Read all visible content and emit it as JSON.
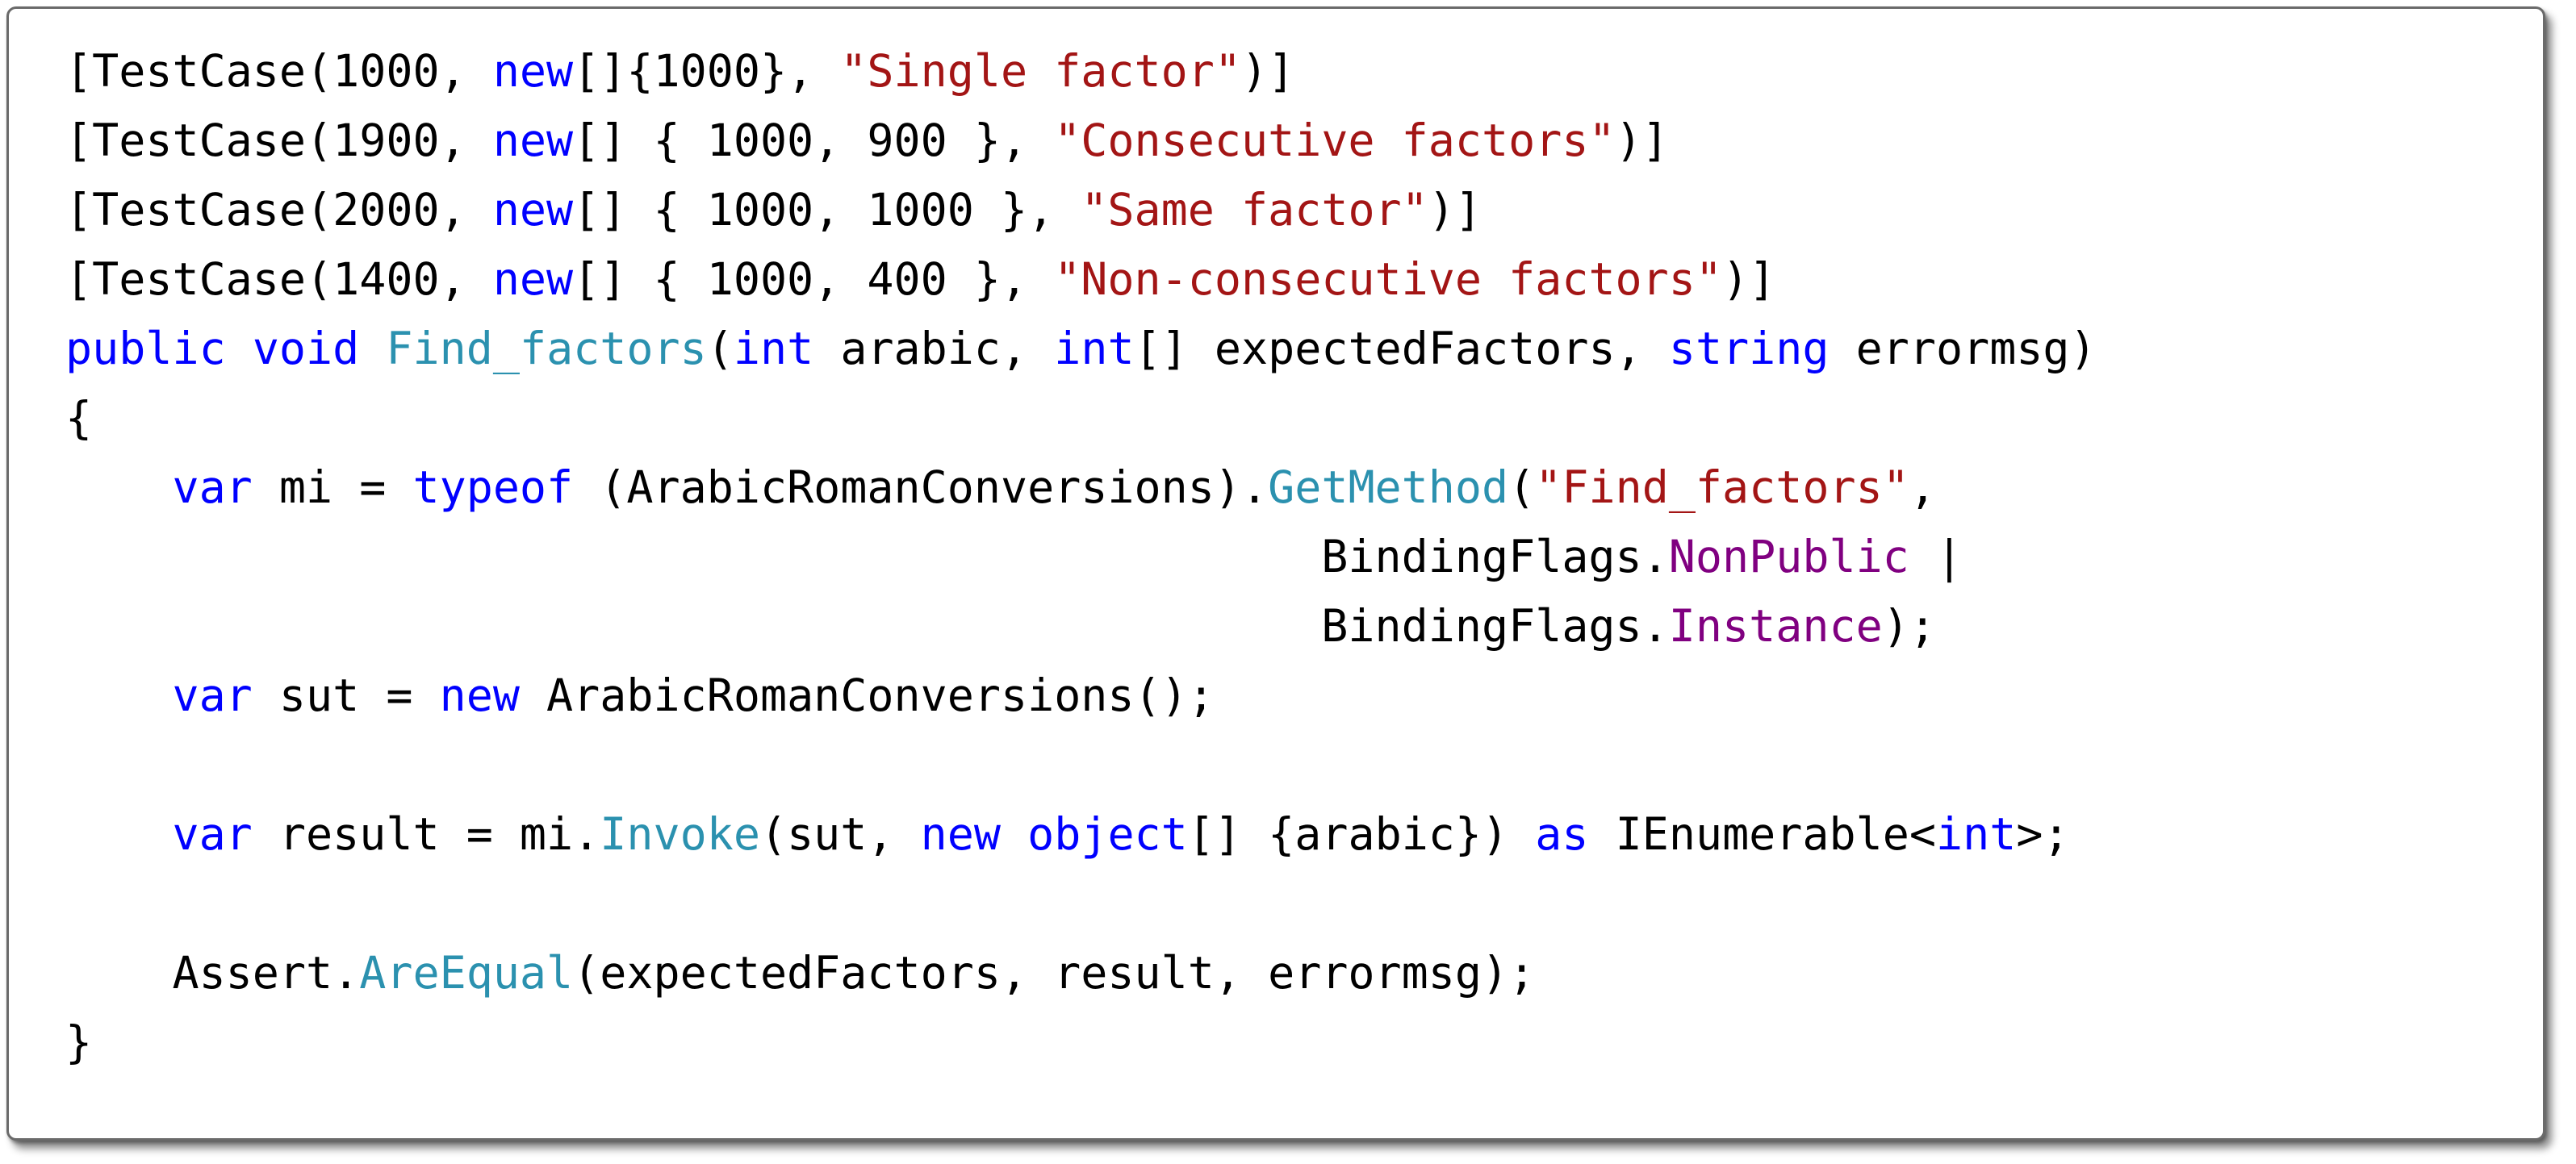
{
  "code": {
    "lines": [
      [
        {
          "t": "[TestCase(1000, ",
          "c": ""
        },
        {
          "t": "new",
          "c": "k"
        },
        {
          "t": "[]{1000}, ",
          "c": ""
        },
        {
          "t": "\"Single factor\"",
          "c": "s"
        },
        {
          "t": ")]",
          "c": ""
        }
      ],
      [
        {
          "t": "[TestCase(1900, ",
          "c": ""
        },
        {
          "t": "new",
          "c": "k"
        },
        {
          "t": "[] { 1000, 900 }, ",
          "c": ""
        },
        {
          "t": "\"Consecutive factors\"",
          "c": "s"
        },
        {
          "t": ")]",
          "c": ""
        }
      ],
      [
        {
          "t": "[TestCase(2000, ",
          "c": ""
        },
        {
          "t": "new",
          "c": "k"
        },
        {
          "t": "[] { 1000, 1000 }, ",
          "c": ""
        },
        {
          "t": "\"Same factor\"",
          "c": "s"
        },
        {
          "t": ")]",
          "c": ""
        }
      ],
      [
        {
          "t": "[TestCase(1400, ",
          "c": ""
        },
        {
          "t": "new",
          "c": "k"
        },
        {
          "t": "[] { 1000, 400 }, ",
          "c": ""
        },
        {
          "t": "\"Non-consecutive factors\"",
          "c": "s"
        },
        {
          "t": ")]",
          "c": ""
        }
      ],
      [
        {
          "t": "public",
          "c": "k"
        },
        {
          "t": " ",
          "c": ""
        },
        {
          "t": "void",
          "c": "k"
        },
        {
          "t": " ",
          "c": ""
        },
        {
          "t": "Find_factors",
          "c": "m"
        },
        {
          "t": "(",
          "c": ""
        },
        {
          "t": "int",
          "c": "k"
        },
        {
          "t": " arabic, ",
          "c": ""
        },
        {
          "t": "int",
          "c": "k"
        },
        {
          "t": "[] expectedFactors, ",
          "c": ""
        },
        {
          "t": "string",
          "c": "k"
        },
        {
          "t": " errormsg)",
          "c": ""
        }
      ],
      [
        {
          "t": "{",
          "c": ""
        }
      ],
      [
        {
          "t": "    ",
          "c": ""
        },
        {
          "t": "var",
          "c": "k"
        },
        {
          "t": " mi = ",
          "c": ""
        },
        {
          "t": "typeof",
          "c": "k"
        },
        {
          "t": " (ArabicRomanConversions).",
          "c": ""
        },
        {
          "t": "GetMethod",
          "c": "m"
        },
        {
          "t": "(",
          "c": ""
        },
        {
          "t": "\"Find_factors\"",
          "c": "s"
        },
        {
          "t": ",",
          "c": ""
        }
      ],
      [
        {
          "t": "                                               BindingFlags.",
          "c": ""
        },
        {
          "t": "NonPublic",
          "c": "p"
        },
        {
          "t": " |",
          "c": ""
        }
      ],
      [
        {
          "t": "                                               BindingFlags.",
          "c": ""
        },
        {
          "t": "Instance",
          "c": "p"
        },
        {
          "t": ");",
          "c": ""
        }
      ],
      [
        {
          "t": "    ",
          "c": ""
        },
        {
          "t": "var",
          "c": "k"
        },
        {
          "t": " sut = ",
          "c": ""
        },
        {
          "t": "new",
          "c": "k"
        },
        {
          "t": " ArabicRomanConversions();",
          "c": ""
        }
      ],
      [
        {
          "t": "",
          "c": ""
        }
      ],
      [
        {
          "t": "    ",
          "c": ""
        },
        {
          "t": "var",
          "c": "k"
        },
        {
          "t": " result = mi.",
          "c": ""
        },
        {
          "t": "Invoke",
          "c": "m"
        },
        {
          "t": "(sut, ",
          "c": ""
        },
        {
          "t": "new",
          "c": "k"
        },
        {
          "t": " ",
          "c": ""
        },
        {
          "t": "object",
          "c": "k"
        },
        {
          "t": "[] {arabic}) ",
          "c": ""
        },
        {
          "t": "as",
          "c": "k"
        },
        {
          "t": " IEnumerable<",
          "c": ""
        },
        {
          "t": "int",
          "c": "k"
        },
        {
          "t": ">;",
          "c": ""
        }
      ],
      [
        {
          "t": "",
          "c": ""
        }
      ],
      [
        {
          "t": "    Assert.",
          "c": ""
        },
        {
          "t": "AreEqual",
          "c": "m"
        },
        {
          "t": "(expectedFactors, result, errormsg);",
          "c": ""
        }
      ],
      [
        {
          "t": "}",
          "c": ""
        }
      ]
    ]
  },
  "colors": {
    "keyword": "#0000ff",
    "string": "#a31515",
    "method": "#2b91af",
    "enum_member": "#800080",
    "plain": "#000000"
  }
}
